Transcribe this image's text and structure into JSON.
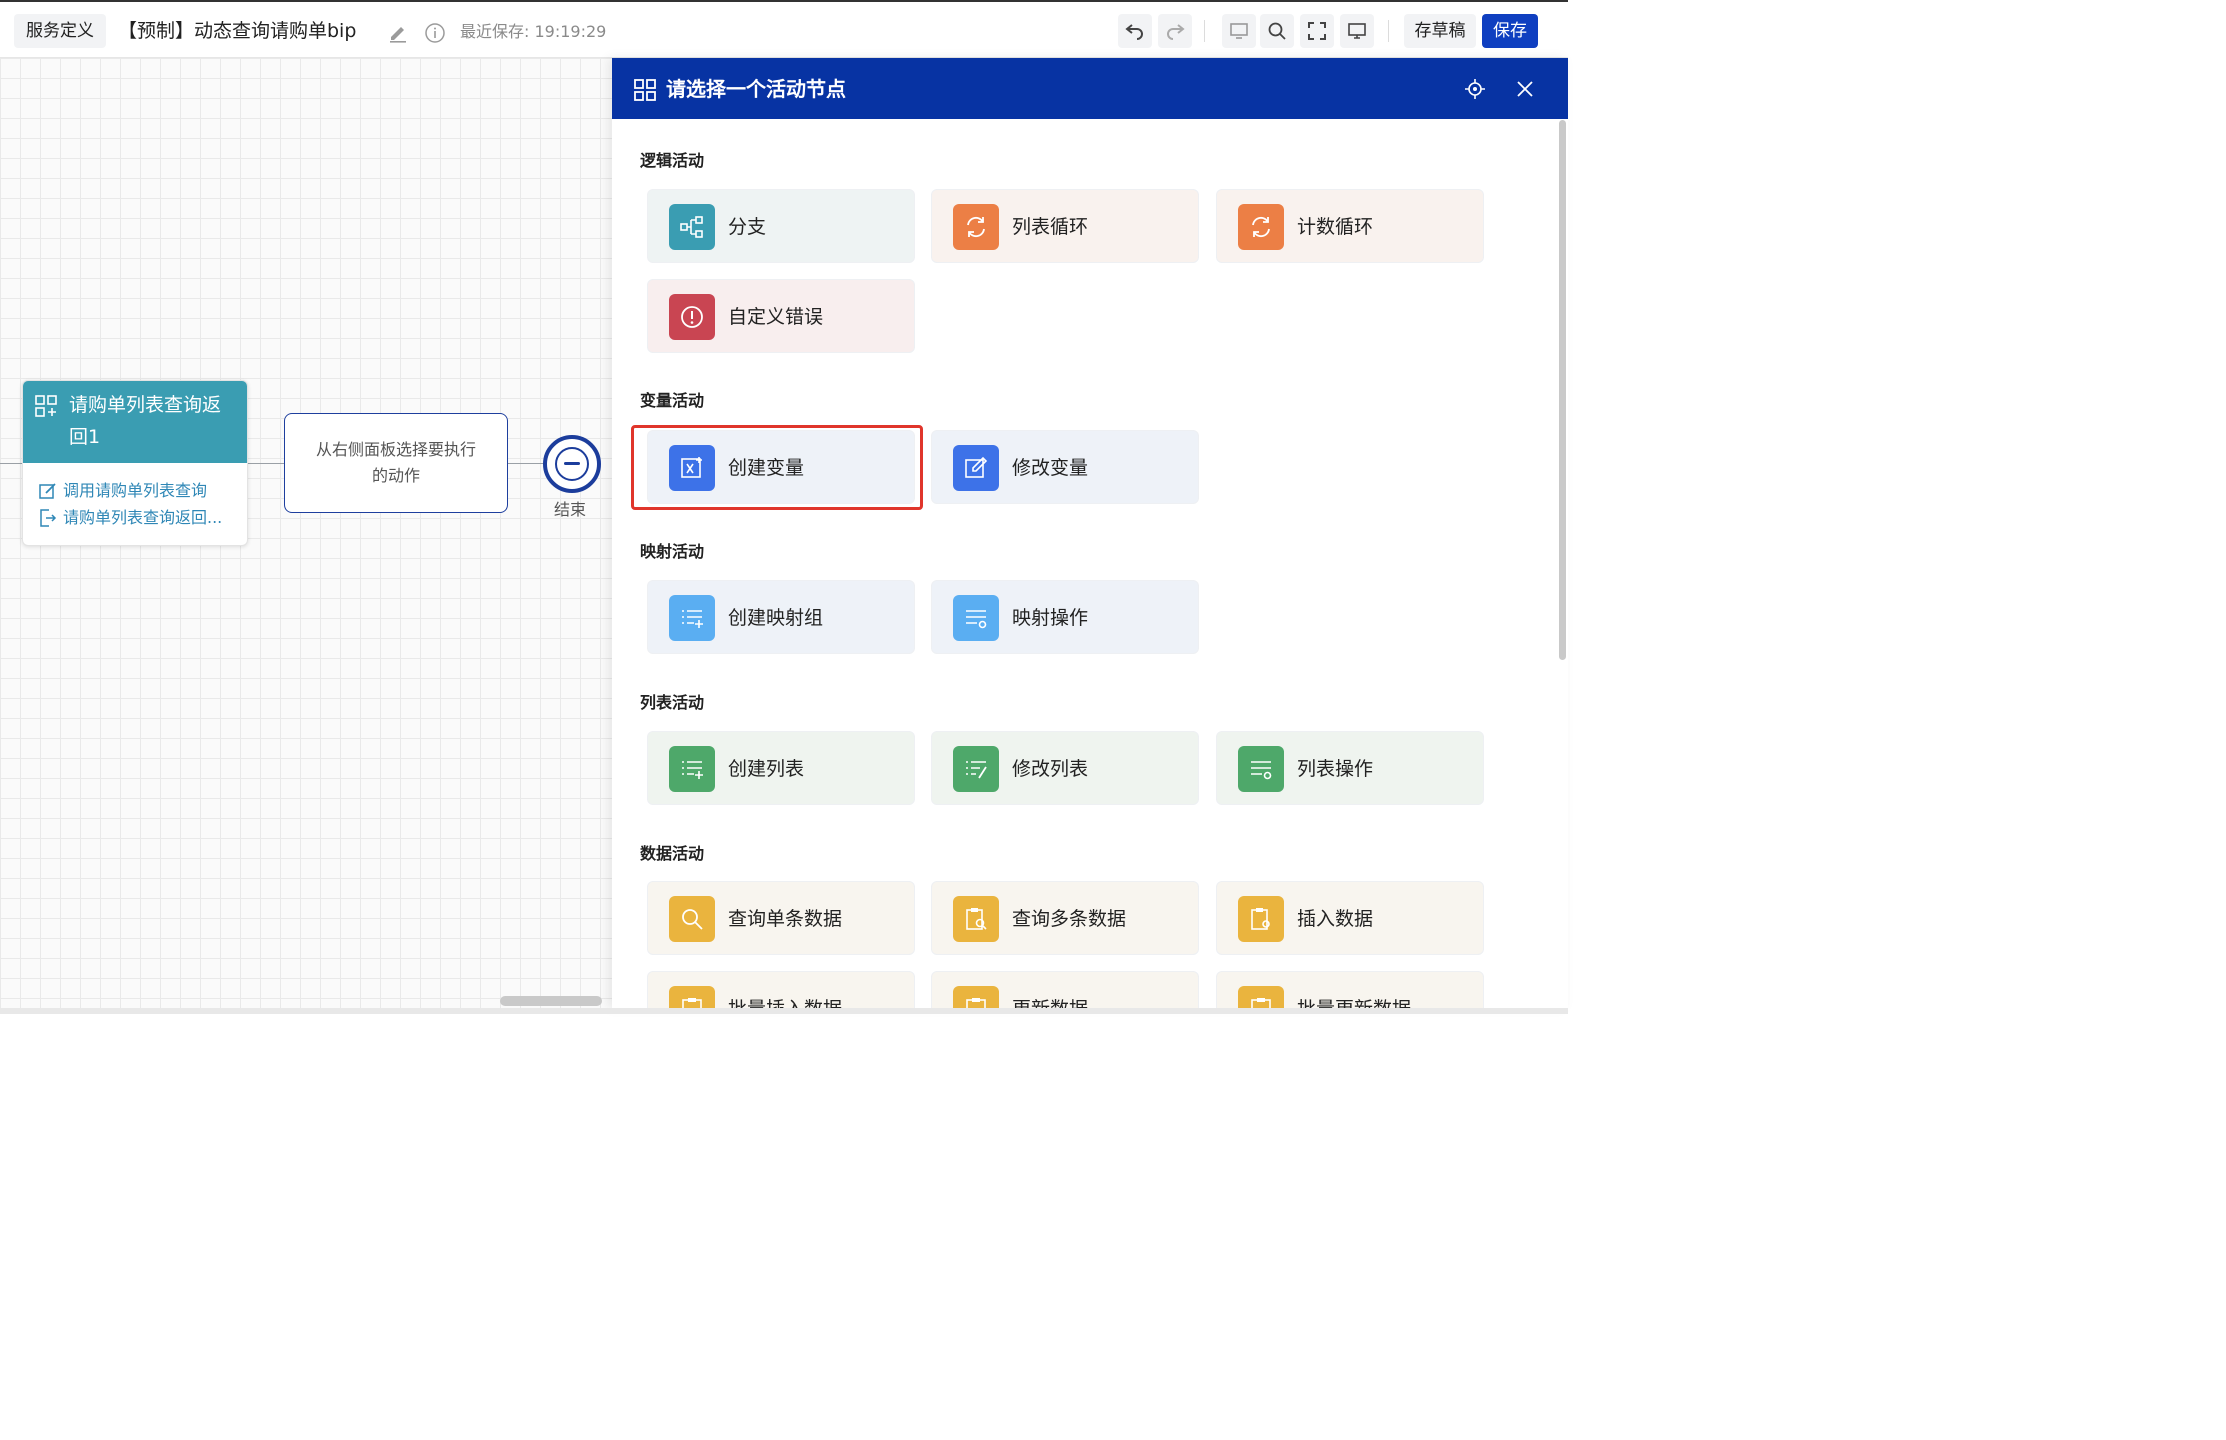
{
  "topbar": {
    "service_def": "服务定义",
    "title": "【预制】动态查询请购单bip",
    "saved": "最近保存: 19:19:29",
    "draft_label": "存草稿",
    "save_label": "保存"
  },
  "canvas": {
    "node": {
      "title_line1": "请购单列表查询返",
      "title_line2": "回1",
      "link1": "调用请购单列表查询",
      "link2": "请购单列表查询返回..."
    },
    "action_placeholder": "从右侧面板选择要执行的动作",
    "end_label": "结束"
  },
  "panel": {
    "title": "请选择一个活动节点",
    "sections": {
      "logic": {
        "title": "逻辑活动",
        "items": [
          {
            "label": "分支",
            "icon": "branch-icon"
          },
          {
            "label": "列表循环",
            "icon": "loop-icon"
          },
          {
            "label": "计数循环",
            "icon": "loop-icon"
          },
          {
            "label": "自定义错误",
            "icon": "error-icon"
          }
        ]
      },
      "variable": {
        "title": "变量活动",
        "items": [
          {
            "label": "创建变量",
            "icon": "create-variable-icon"
          },
          {
            "label": "修改变量",
            "icon": "edit-icon"
          }
        ]
      },
      "mapping": {
        "title": "映射活动",
        "items": [
          {
            "label": "创建映射组",
            "icon": "list-add-icon"
          },
          {
            "label": "映射操作",
            "icon": "list-gear-icon"
          }
        ]
      },
      "list": {
        "title": "列表活动",
        "items": [
          {
            "label": "创建列表",
            "icon": "list-add-icon"
          },
          {
            "label": "修改列表",
            "icon": "list-edit-icon"
          },
          {
            "label": "列表操作",
            "icon": "list-gear-icon"
          }
        ]
      },
      "data": {
        "title": "数据活动",
        "items": [
          {
            "label": "查询单条数据",
            "icon": "search-icon"
          },
          {
            "label": "查询多条数据",
            "icon": "clipboard-search-icon"
          },
          {
            "label": "插入数据",
            "icon": "clipboard-gear-icon"
          },
          {
            "label": "批量插入数据",
            "icon": "clipboard-icon"
          },
          {
            "label": "更新数据",
            "icon": "clipboard-icon"
          },
          {
            "label": "批量更新数据",
            "icon": "clipboard-icon"
          }
        ]
      }
    }
  }
}
